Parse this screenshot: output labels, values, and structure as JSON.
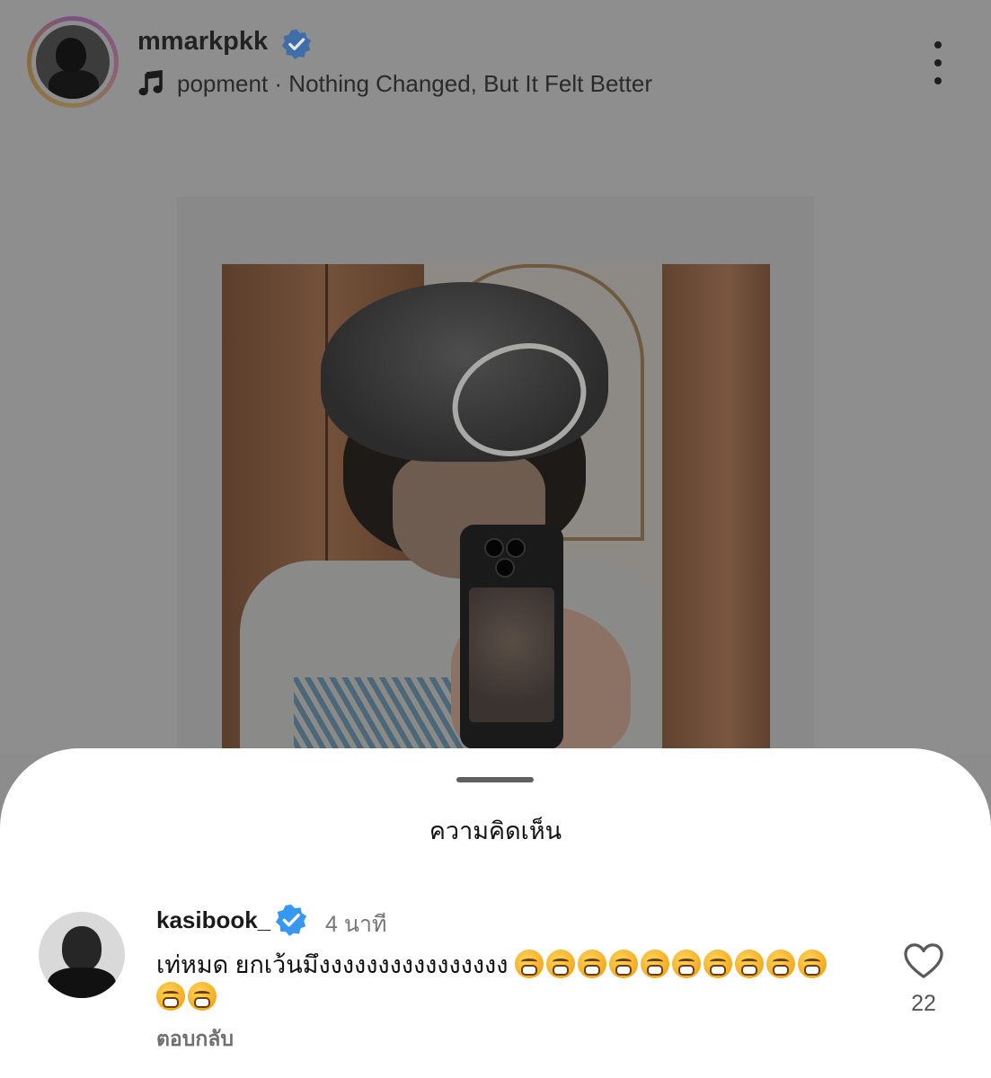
{
  "post": {
    "username": "mmarkpkk",
    "verified": true,
    "music_artist": "popment",
    "music_separator": " · ",
    "music_title": "Nothing Changed, But It Felt Better",
    "more_icon": "more-vertical-icon",
    "music_icon": "music-note-icon"
  },
  "sheet": {
    "title": "ความคิดเห็น"
  },
  "comment": {
    "username": "kasibook_",
    "verified": true,
    "time": "4 นาที",
    "text": "เท่หมด ยกเว้นมึงงงงงงงงงงงงงงงง",
    "emoji_count": 12,
    "emoji_name": "face-with-steam-from-nose",
    "reply_label": "ตอบกลับ",
    "like_count": "22"
  },
  "colors": {
    "overlay": "#8e8e8e",
    "verified_blue": "#3897f0",
    "sheet_bg": "#ffffff"
  }
}
